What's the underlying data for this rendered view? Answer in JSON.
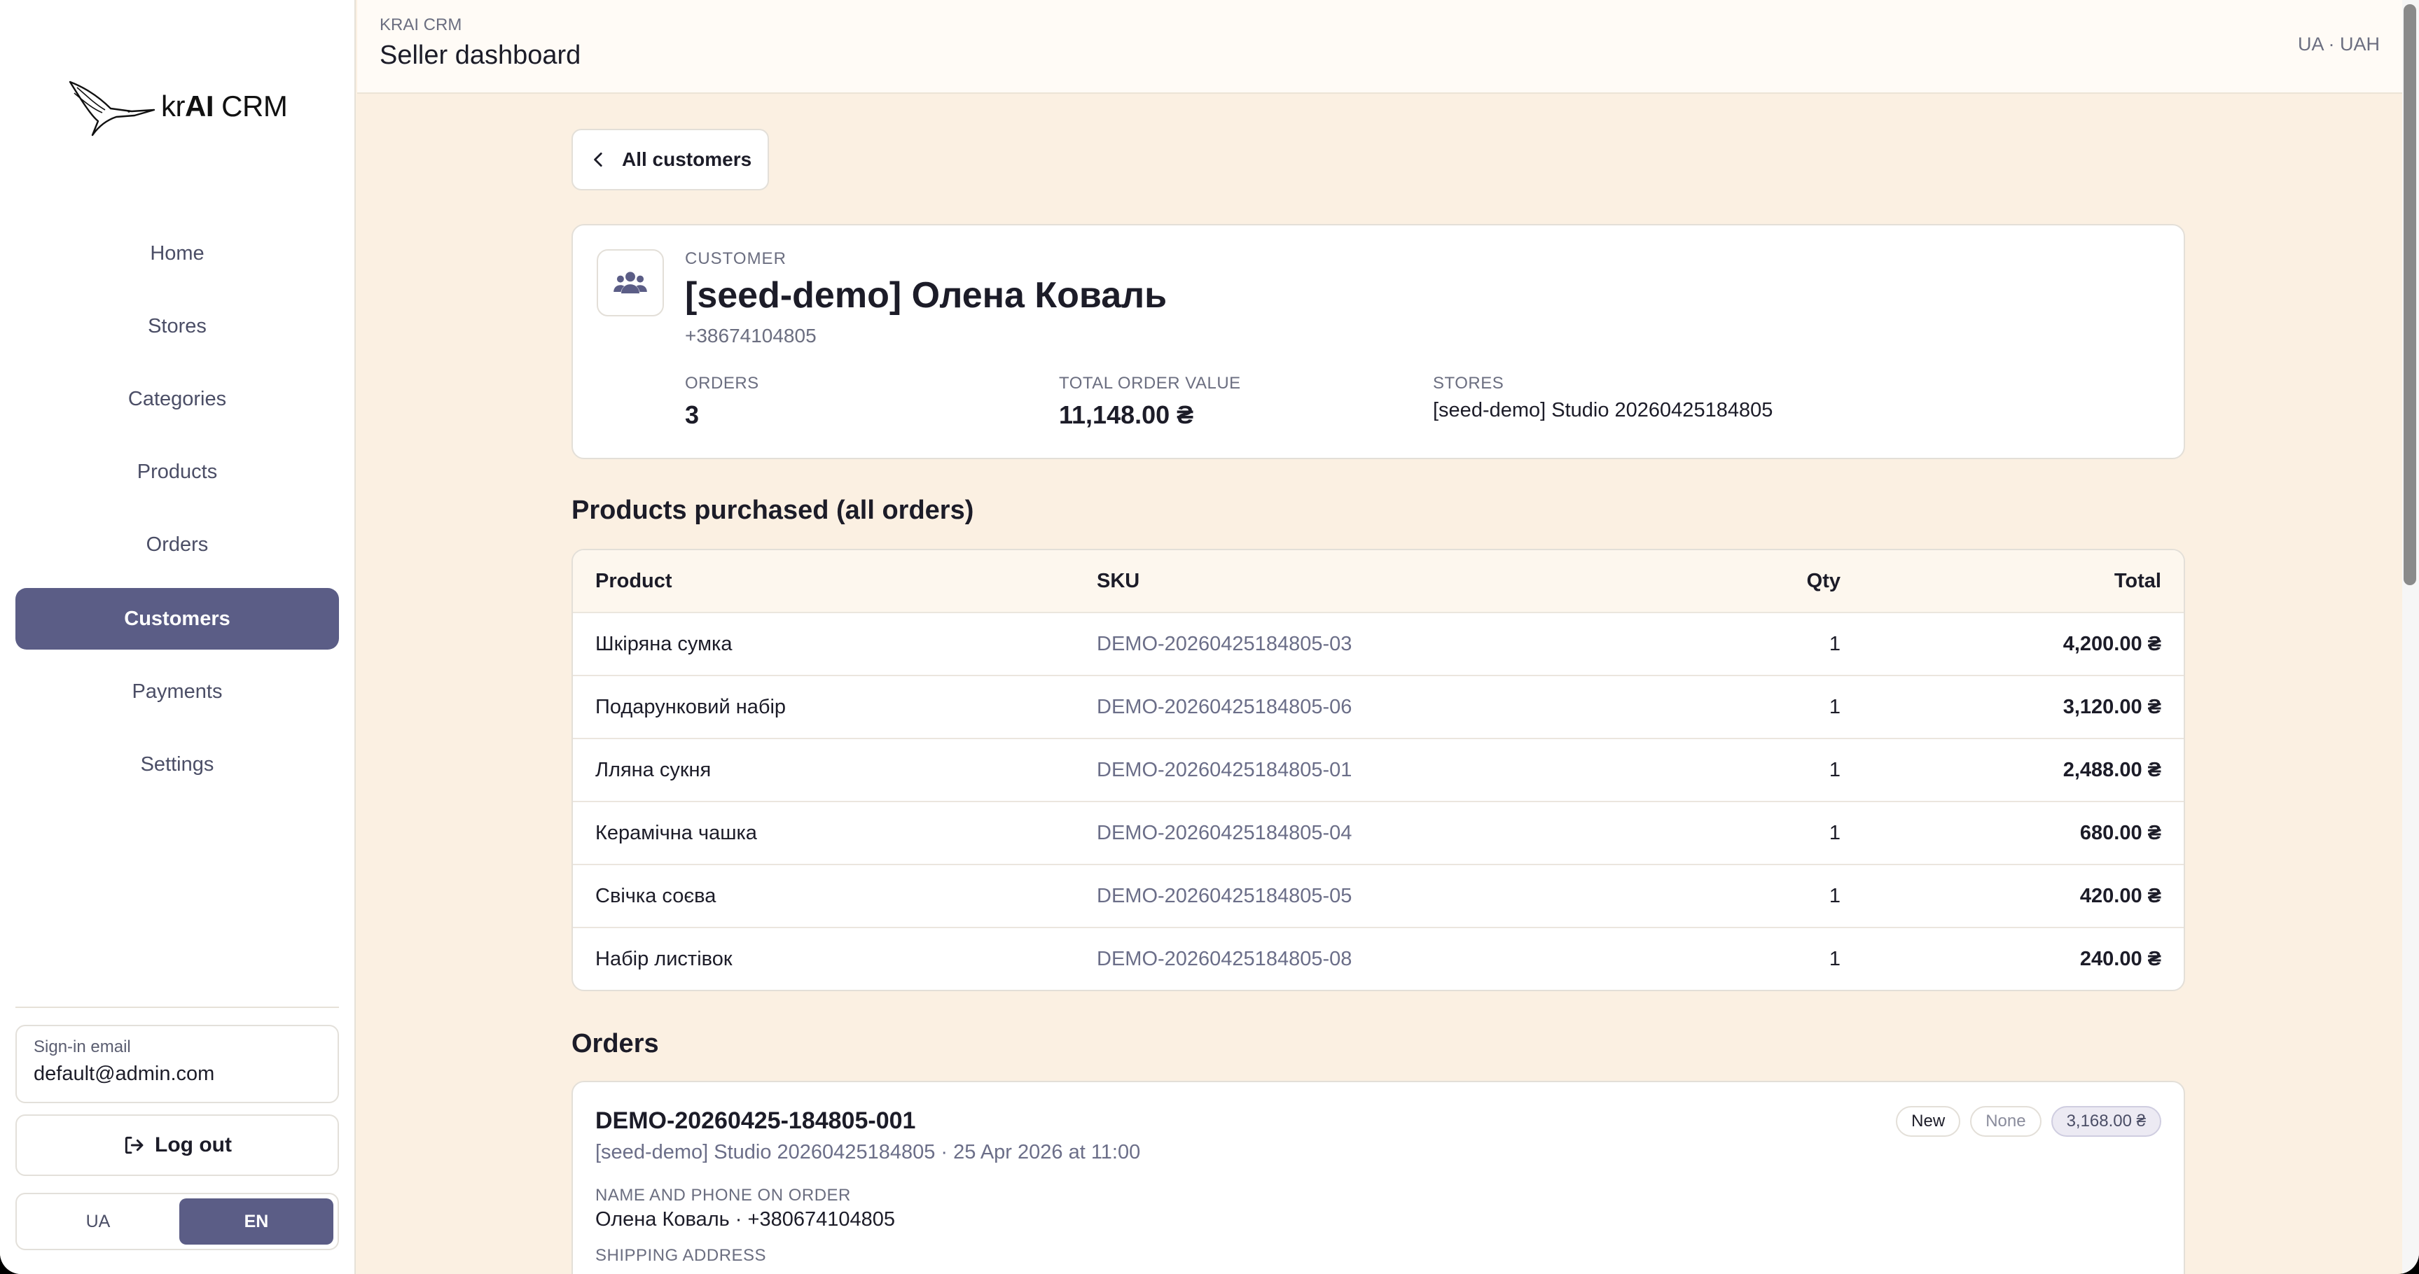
{
  "sidebar": {
    "logo_prefix": "kr",
    "logo_ai": "AI",
    "logo_suffix": " CRM",
    "nav": [
      {
        "label": "Home"
      },
      {
        "label": "Stores"
      },
      {
        "label": "Categories"
      },
      {
        "label": "Products"
      },
      {
        "label": "Orders"
      },
      {
        "label": "Customers",
        "active": true
      },
      {
        "label": "Payments"
      },
      {
        "label": "Settings"
      }
    ],
    "signin_label": "Sign-in email",
    "signin_email": "default@admin.com",
    "logout_label": "Log out",
    "lang_options": [
      "UA",
      "EN"
    ],
    "lang_active": "EN"
  },
  "header": {
    "app_name": "KRAI CRM",
    "title": "Seller dashboard",
    "locale": "UA · UAH"
  },
  "back_button": "All customers",
  "customer": {
    "eyebrow": "CUSTOMER",
    "name": "[seed-demo] Олена Коваль",
    "phone": "+38674104805",
    "orders_label": "ORDERS",
    "orders_value": "3",
    "total_label": "TOTAL ORDER VALUE",
    "total_value": "11,148.00 ₴",
    "stores_label": "STORES",
    "stores_value": "[seed-demo] Studio 20260425184805"
  },
  "products_section": {
    "title": "Products purchased (all orders)",
    "columns": {
      "product": "Product",
      "sku": "SKU",
      "qty": "Qty",
      "total": "Total"
    },
    "rows": [
      {
        "product": "Шкіряна сумка",
        "sku": "DEMO-20260425184805-03",
        "qty": "1",
        "total": "4,200.00 ₴"
      },
      {
        "product": "Подарунковий набір",
        "sku": "DEMO-20260425184805-06",
        "qty": "1",
        "total": "3,120.00 ₴"
      },
      {
        "product": "Лляна сукня",
        "sku": "DEMO-20260425184805-01",
        "qty": "1",
        "total": "2,488.00 ₴"
      },
      {
        "product": "Керамічна чашка",
        "sku": "DEMO-20260425184805-04",
        "qty": "1",
        "total": "680.00 ₴"
      },
      {
        "product": "Свічка соєва",
        "sku": "DEMO-20260425184805-05",
        "qty": "1",
        "total": "420.00 ₴"
      },
      {
        "product": "Набір листівок",
        "sku": "DEMO-20260425184805-08",
        "qty": "1",
        "total": "240.00 ₴"
      }
    ]
  },
  "orders_section": {
    "title": "Orders",
    "order": {
      "id": "DEMO-20260425-184805-001",
      "meta": "[seed-demo] Studio 20260425184805 · 25 Apr 2026 at 11:00",
      "status_badge": "New",
      "payment_badge": "None",
      "amount_badge": "3,168.00 ₴",
      "name_phone_label": "NAME AND PHONE ON ORDER",
      "name_phone_value": "Олена Коваль · +380674104805",
      "shipping_label": "SHIPPING ADDRESS"
    }
  },
  "colors": {
    "accent": "#5b5d86",
    "page_bg": "#fbf0e2",
    "card_bg": "#ffffff"
  }
}
